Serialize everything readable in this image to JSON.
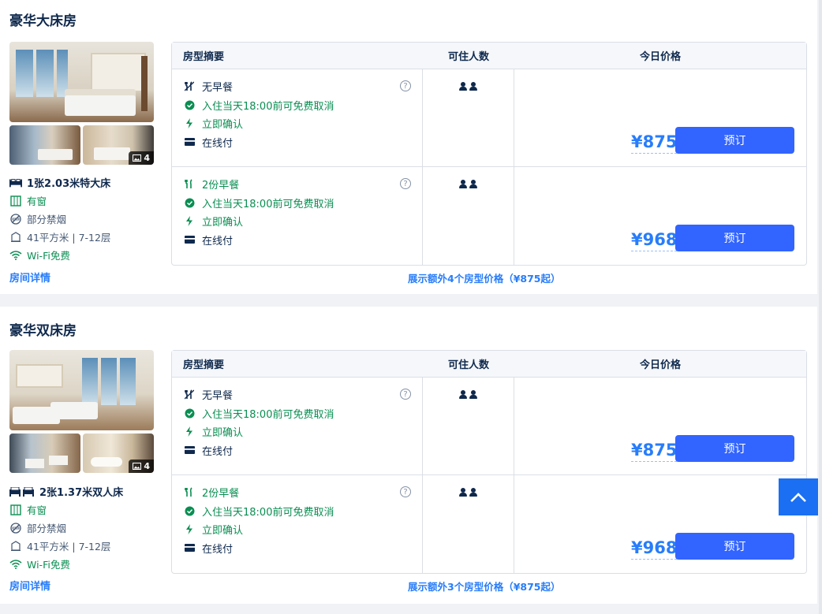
{
  "rooms": [
    {
      "title": "豪华大床房",
      "photo_count": "4",
      "bed": "1张2.03米特大床",
      "window": "有窗",
      "smoking": "部分禁烟",
      "area_floor": "41平方米 | 7-12层",
      "wifi": "Wi-Fi免费",
      "detail_link": "房间详情",
      "more_link": "展示额外4个房型价格（¥875起）",
      "offers": [
        {
          "meal": "无早餐",
          "cancel": "入住当天18:00前可免费取消",
          "confirm": "立即确认",
          "payment": "在线付",
          "price": "¥875",
          "book": "预订"
        },
        {
          "meal": "2份早餐",
          "cancel": "入住当天18:00前可免费取消",
          "confirm": "立即确认",
          "payment": "在线付",
          "price": "¥968",
          "book": "预订"
        }
      ]
    },
    {
      "title": "豪华双床房",
      "photo_count": "4",
      "bed": "2张1.37米双人床",
      "window": "有窗",
      "smoking": "部分禁烟",
      "area_floor": "41平方米 | 7-12层",
      "wifi": "Wi-Fi免费",
      "detail_link": "房间详情",
      "more_link": "展示额外3个房型价格（¥875起）",
      "offers": [
        {
          "meal": "无早餐",
          "cancel": "入住当天18:00前可免费取消",
          "confirm": "立即确认",
          "payment": "在线付",
          "price": "¥875",
          "book": "预订"
        },
        {
          "meal": "2份早餐",
          "cancel": "入住当天18:00前可免费取消",
          "confirm": "立即确认",
          "payment": "在线付",
          "price": "¥968",
          "book": "预订"
        }
      ]
    }
  ],
  "table_headers": {
    "summary": "房型摘要",
    "guests": "可住人数",
    "price": "今日价格"
  },
  "help_glyph": "?",
  "colors": {
    "accent": "#287dfa",
    "button": "#3264ff",
    "green": "#0a8e52",
    "text": "#0f294d",
    "back_top": "#1a6ff3"
  }
}
